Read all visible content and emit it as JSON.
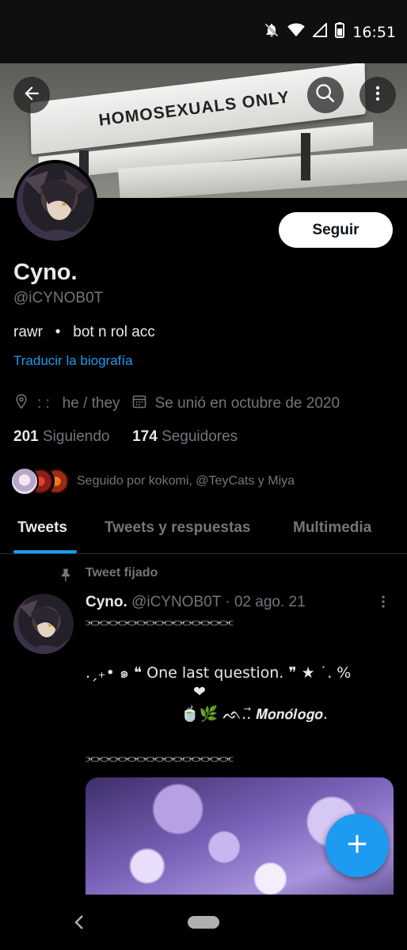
{
  "status_bar": {
    "time": "16:51",
    "icons": [
      "notifications-off-icon",
      "wifi-icon",
      "cellular-signal-icon",
      "battery-icon"
    ]
  },
  "banner": {
    "bench_text": "HOMOSEXUALS ONLY",
    "icons": [
      "back-arrow-icon",
      "search-icon",
      "more-vertical-icon"
    ]
  },
  "profile": {
    "follow_label": "Seguir",
    "name": "Cyno.",
    "handle": "@iCYNOB0T",
    "bio": "rawr   •   bot n rol acc",
    "translate_label": "Traducir la biografía",
    "location": ": :   he / they",
    "joined": "Se unió en octubre de 2020",
    "following_count": "201",
    "following_label": "Siguiendo",
    "followers_count": "174",
    "followers_label": "Seguidores",
    "followed_by": "Seguido por kokomi, @TeyCats y Miya"
  },
  "tabs": [
    "Tweets",
    "Tweets y respuestas",
    "Multimedia"
  ],
  "tweet": {
    "pinned_label": "Tweet fijado",
    "author_name": "Cyno.",
    "author_handle": "@iCYNOB0T",
    "separator": "·",
    "date": "02 ago. 21",
    "line1": "⫘⫘⫘⫘⫘⫘⫘⫘⫘⫘⫘⫘⫘⫘⫘⫘",
    "line2": ".ˏ₊• ๑ ❝ One last question. ❞  ★ ˙. %",
    "line3": "❤",
    "line4": "🍵🌿 ᨒ..⃗ 𝙈𝙤𝙣𝙤́𝙡𝙤𝙜𝙤.",
    "line5": "⫘⫘⫘⫘⫘⫘⫘⫘⫘⫘⫘⫘⫘⫘⫘⫘"
  },
  "colors": {
    "accent": "#1d9bf0",
    "background": "#000000",
    "text_primary": "#e7e9ea",
    "text_secondary": "#71767b"
  }
}
